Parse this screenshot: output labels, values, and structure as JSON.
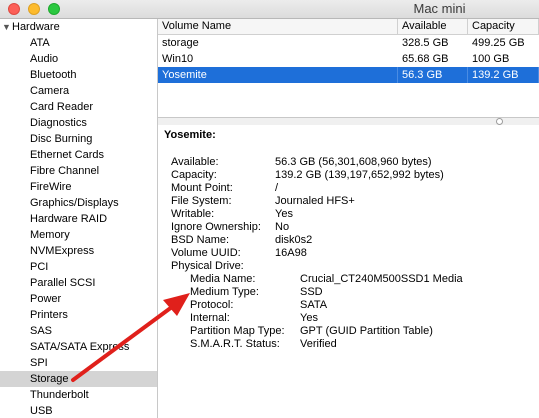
{
  "window": {
    "title": "Mac mini"
  },
  "sidebar": {
    "group_label": "Hardware",
    "items": [
      "ATA",
      "Audio",
      "Bluetooth",
      "Camera",
      "Card Reader",
      "Diagnostics",
      "Disc Burning",
      "Ethernet Cards",
      "Fibre Channel",
      "FireWire",
      "Graphics/Displays",
      "Hardware RAID",
      "Memory",
      "NVMExpress",
      "PCI",
      "Parallel SCSI",
      "Power",
      "Printers",
      "SAS",
      "SATA/SATA Express",
      "SPI",
      "Storage",
      "Thunderbolt",
      "USB"
    ],
    "selected": "Storage"
  },
  "volumes": {
    "headers": [
      "Volume Name",
      "Available",
      "Capacity"
    ],
    "rows": [
      [
        "storage",
        "328.5 GB",
        "499.25 GB"
      ],
      [
        "Win10",
        "65.68 GB",
        "100 GB"
      ],
      [
        "Yosemite",
        "56.3 GB",
        "139.2 GB"
      ]
    ]
  },
  "details": {
    "title": "Yosemite:",
    "fields": [
      {
        "key": "Available:",
        "value": "56.3 GB (56,301,608,960 bytes)"
      },
      {
        "key": "Capacity:",
        "value": "139.2 GB (139,197,652,992 bytes)"
      },
      {
        "key": "Mount Point:",
        "value": "/"
      },
      {
        "key": "File System:",
        "value": "Journaled HFS+"
      },
      {
        "key": "Writable:",
        "value": "Yes"
      },
      {
        "key": "Ignore Ownership:",
        "value": "No"
      },
      {
        "key": "BSD Name:",
        "value": "disk0s2"
      },
      {
        "key": "Volume UUID:",
        "value": "16A98"
      },
      {
        "key": "Physical Drive:",
        "value": ""
      }
    ],
    "physical_drive": [
      {
        "key": "Media Name:",
        "value": "Crucial_CT240M500SSD1 Media"
      },
      {
        "key": "Medium Type:",
        "value": "SSD"
      },
      {
        "key": "Protocol:",
        "value": "SATA"
      },
      {
        "key": "Internal:",
        "value": "Yes"
      },
      {
        "key": "Partition Map Type:",
        "value": "GPT (GUID Partition Table)"
      },
      {
        "key": "S.M.A.R.T. Status:",
        "value": "Verified"
      }
    ]
  },
  "colors": {
    "selection": "#1e6fd9",
    "arrow": "#e0201b"
  }
}
